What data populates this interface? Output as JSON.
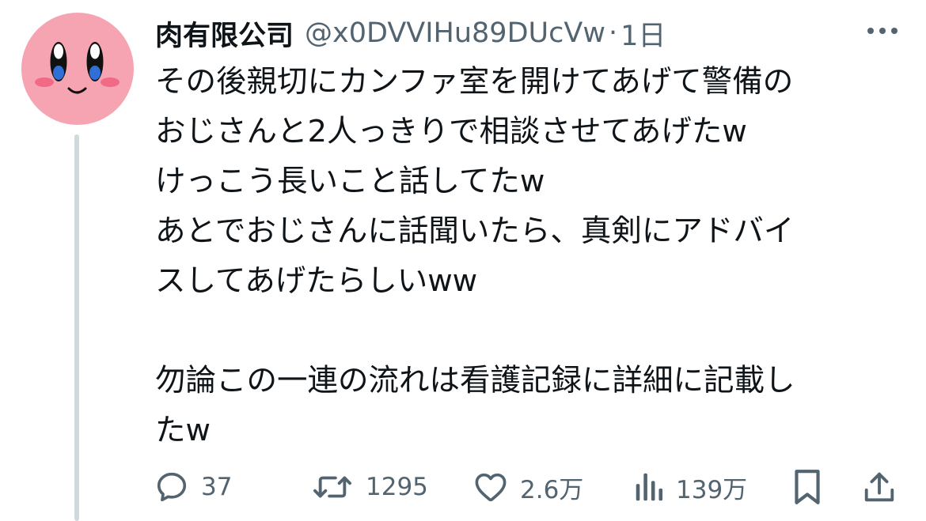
{
  "author": {
    "display_name": "肉有限公司",
    "handle": "@x0DVVIHu89DUcVw",
    "separator": "·",
    "time": "1日"
  },
  "tweet": {
    "text": "その後親切にカンファ室を開けてあげて警備の\nおじさんと2人っきりで相談させてあげたw\nけっこう長いこと話してたw\nあとでおじさんに話聞いたら、真剣にアドバイ\nスしてあげたらしいww\n\n勿論この一連の流れは看護記録に詳細に記載し\nたw"
  },
  "actions": {
    "replies": "37",
    "reposts": "1295",
    "likes": "2.6万",
    "views": "139万"
  },
  "icons": {
    "avatar": "kirby-face-avatar",
    "more": "more-dots-icon",
    "reply": "reply-bubble-icon",
    "repost": "repost-arrows-icon",
    "like": "heart-icon",
    "views": "bar-chart-icon",
    "bookmark": "bookmark-icon",
    "share": "share-upload-icon"
  },
  "colors": {
    "text_primary": "#0f1419",
    "text_secondary": "#536471",
    "thread_line": "#cfd9de",
    "avatar_bg": "#f6a3b2"
  }
}
